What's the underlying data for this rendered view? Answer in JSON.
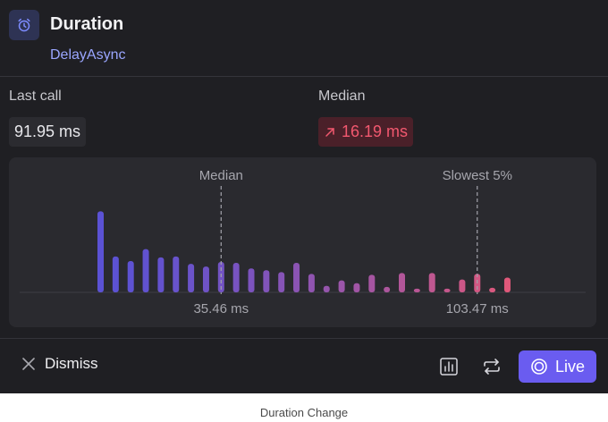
{
  "header": {
    "title": "Duration",
    "subtitle": "DelayAsync",
    "icon": "alarm-clock-icon"
  },
  "stats": {
    "last_call_label": "Last call",
    "last_call_value": "91.95 ms",
    "median_label": "Median",
    "median_value": "16.19 ms",
    "median_trend_icon": "arrow-up-right-icon"
  },
  "chart_data": {
    "type": "bar",
    "title": "",
    "xlabel": "",
    "ylabel": "",
    "bars": [
      0.88,
      0.39,
      0.34,
      0.47,
      0.38,
      0.39,
      0.31,
      0.28,
      0.33,
      0.32,
      0.26,
      0.24,
      0.22,
      0.32,
      0.2,
      0.07,
      0.13,
      0.1,
      0.19,
      0.06,
      0.21,
      0.04,
      0.21,
      0.04,
      0.14,
      0.2,
      0.05,
      0.16
    ],
    "markers": [
      {
        "label": "Median",
        "value_label": "35.46 ms",
        "bar_index": 8
      },
      {
        "label": "Slowest 5%",
        "value_label": "103.47 ms",
        "bar_index": 25
      }
    ],
    "colors": {
      "start": "#5b52d4",
      "end": "#e0587a",
      "baseline": "#3d3d44"
    }
  },
  "footer": {
    "dismiss_label": "Dismiss",
    "live_label": "Live"
  },
  "caption": "Duration Change",
  "colors": {
    "accent": "#6a5cf0",
    "panel": "#1f1f23",
    "card": "#2a2a2f",
    "danger": "#f2586f"
  }
}
